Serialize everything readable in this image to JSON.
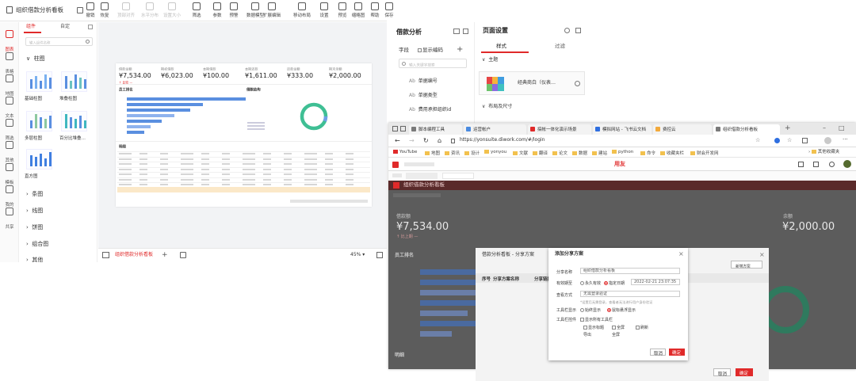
{
  "left": {
    "title": "组织借款分析看板",
    "toolbar": [
      {
        "label": "撤销",
        "icon": "undo-icon",
        "enabled": true
      },
      {
        "label": "恢复",
        "icon": "redo-icon",
        "enabled": true
      },
      {
        "label": "顶部对齐",
        "icon": "align-top-icon",
        "enabled": false
      },
      {
        "label": "水平分布",
        "icon": "distribute-h-icon",
        "enabled": false
      },
      {
        "label": "设置大小",
        "icon": "resize-icon",
        "enabled": false
      },
      {
        "label": "筛选",
        "icon": "filter-icon",
        "enabled": true
      },
      {
        "label": "参数",
        "icon": "parameter-icon",
        "enabled": true
      },
      {
        "label": "预警",
        "icon": "alert-icon",
        "enabled": true
      },
      {
        "label": "数据模型",
        "icon": "data-model-icon",
        "enabled": true
      },
      {
        "label": "扩展编辑",
        "icon": "extend-edit-icon",
        "enabled": true
      },
      {
        "label": "移动布局",
        "icon": "mobile-layout-icon",
        "enabled": true
      },
      {
        "label": "设置",
        "icon": "settings-icon",
        "enabled": true
      },
      {
        "label": "预览",
        "icon": "preview-icon",
        "enabled": true
      },
      {
        "label": "缩略图",
        "icon": "thumbnail-icon",
        "enabled": true
      },
      {
        "label": "帮助",
        "icon": "help-icon",
        "enabled": true
      },
      {
        "label": "保存",
        "icon": "save-icon",
        "enabled": true
      }
    ],
    "iconbar": [
      {
        "label": "图表",
        "icon": "chart-icon",
        "active": true
      },
      {
        "label": "表格",
        "icon": "table-icon"
      },
      {
        "label": "地图",
        "icon": "map-icon"
      },
      {
        "label": "文本",
        "icon": "text-icon"
      },
      {
        "label": "筛选",
        "icon": "filter-icon"
      },
      {
        "label": "其他",
        "icon": "other-icon"
      },
      {
        "label": "模板",
        "icon": "template-icon"
      },
      {
        "label": "我的",
        "icon": "user-icon"
      },
      {
        "label": "共享",
        "icon": "share-icon"
      }
    ],
    "panel_tabs": [
      "组件",
      "自定"
    ],
    "search_placeholder": "输入组件名称",
    "groups": {
      "open": "柱图",
      "closed": [
        "条图",
        "线图",
        "饼图",
        "组合图",
        "其他"
      ]
    },
    "thumbs": [
      "基础柱图",
      "堆叠柱图",
      "多层柱图",
      "百分比堆叠…",
      "直方图"
    ],
    "kpis": [
      {
        "label": "借款金额",
        "value": "¥7,534.00",
        "sub": "↑ 比较 —",
        "color": "#e02a2a"
      },
      {
        "label": "期初借款",
        "value": "¥6,023.00"
      },
      {
        "label": "本期借款",
        "value": "¥100.00"
      },
      {
        "label": "本期还款",
        "value": "¥1,611.00"
      },
      {
        "label": "还款金额",
        "value": "¥333.00"
      },
      {
        "label": "期末余额",
        "value": "¥2,000.00"
      }
    ],
    "board_sections": [
      "员工排名",
      "借款结构",
      "明细"
    ],
    "sheet_tab": "组织借款分析看板",
    "zoom": "45%"
  },
  "mid": {
    "title": "借款分析",
    "field_label": "字段",
    "show_code": "显示编码",
    "search_placeholder": "输入关键字搜索",
    "fields": [
      "单据编号",
      "单据类型",
      "费用承担组织id"
    ]
  },
  "right": {
    "title": "页面设置",
    "tabs": [
      "样式",
      "过滤"
    ],
    "theme_label": "主题",
    "theme_name": "经典商白（仪表…",
    "layout_label": "布局及尺寸"
  },
  "browser": {
    "tabs": [
      {
        "label": "脚本编程工具",
        "color": "#7a7a7a"
      },
      {
        "label": "运营帐户",
        "color": "#4a8be0"
      },
      {
        "label": "搞帐一体化演示场景",
        "color": "#e02a2a"
      },
      {
        "label": "模拟网站 - 飞书云文档",
        "color": "#2f6fe0"
      },
      {
        "label": "费控云",
        "color": "#f2a93b"
      },
      {
        "label": "组织借款分析看板",
        "color": "#7a7a7a"
      }
    ],
    "url": "https://yonsuite.diwork.com/#/login",
    "bookmarks": [
      "YouTube",
      "地图",
      "资讯",
      "设计",
      "yonyou",
      "文献",
      "翻译",
      "论文",
      "数据",
      "建站",
      "python",
      "命令",
      "收藏夹栏",
      "财会开发网"
    ],
    "other_bookmarks": "其他收藏夹",
    "brand": "用友",
    "dash_title": "组织借款分析看板",
    "dash_kpi_left": "¥7,534.00",
    "dash_kpi_left_label": "借款额",
    "dash_kpi_left_sub": "↑ 比上期 —",
    "dash_kpi_right": "¥2,000.00",
    "dash_kpi_right_label": "余额",
    "dash_section1": "员工排名",
    "dash_section2": "明细",
    "bg_dialog_title": "借款分析看板 - 分享方案",
    "bg_dialog_btn": "新增方案",
    "bg_cols": [
      "序号",
      "分享方案名称",
      "分享链接"
    ],
    "bg_cancel": "取消",
    "bg_ok": "确定",
    "dialog": {
      "title": "添加分享方案",
      "name_label": "分享名称",
      "name_value": "组织借款分析看板",
      "validity_label": "有效期至",
      "validity_opt1": "永久有效",
      "validity_opt2": "指定日期",
      "validity_date": "2022-02-21 23:07:35",
      "auth_label": "查看方式",
      "auth_value": "无需登录验证",
      "auth_note": "*设置后无需登录，查看者无法进行用户身份验证",
      "toolbar_label": "工具栏显示",
      "toolbar_opt1": "始终显示",
      "toolbar_opt2": "鼠标悬浮显示",
      "ctrl_label": "工具栏控件",
      "ctrl_all": "显示所有工具栏",
      "ctrl_items": [
        "显示标题",
        "全屏",
        "刷新",
        "导出",
        "全屏"
      ],
      "cancel": "取消",
      "ok": "确定"
    }
  }
}
